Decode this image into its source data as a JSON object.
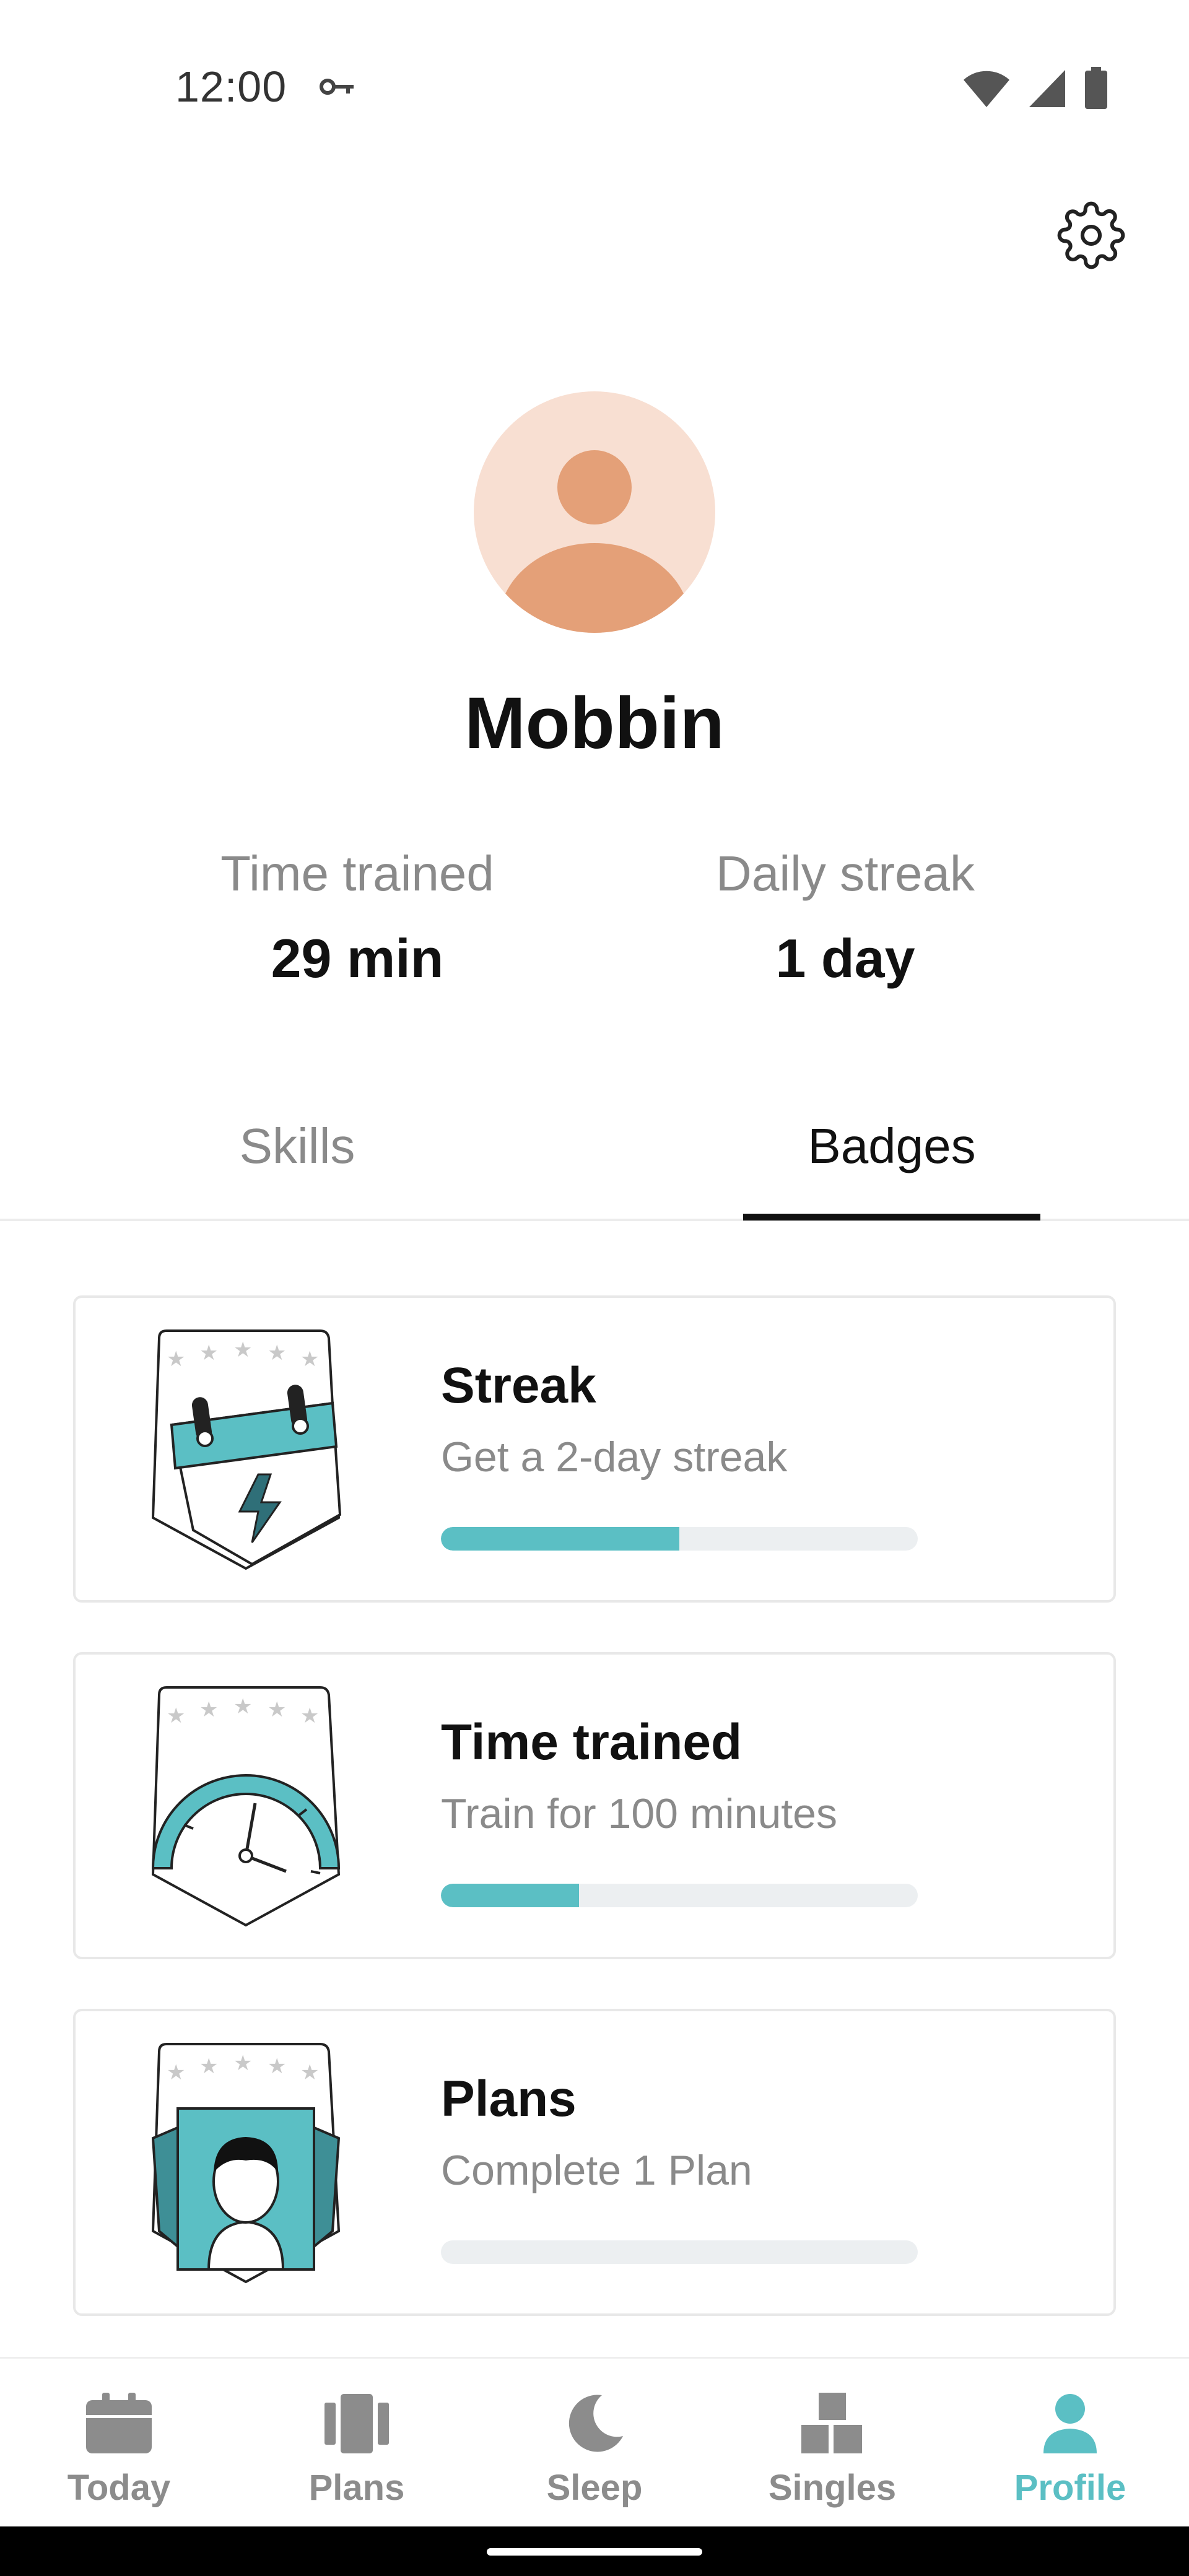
{
  "status_bar": {
    "time": "12:00"
  },
  "profile": {
    "name": "Mobbin"
  },
  "stats": [
    {
      "label": "Time trained",
      "value": "29 min"
    },
    {
      "label": "Daily streak",
      "value": "1 day"
    }
  ],
  "tabs": [
    {
      "label": "Skills",
      "active": false
    },
    {
      "label": "Badges",
      "active": true
    }
  ],
  "badges": [
    {
      "title": "Streak",
      "subtitle": "Get a 2-day streak",
      "progress": 0.5
    },
    {
      "title": "Time trained",
      "subtitle": "Train for 100 minutes",
      "progress": 0.29
    },
    {
      "title": "Plans",
      "subtitle": "Complete 1 Plan",
      "progress": 0
    }
  ],
  "nav": [
    {
      "label": "Today",
      "icon": "calendar-icon",
      "active": false
    },
    {
      "label": "Plans",
      "icon": "plans-icon",
      "active": false
    },
    {
      "label": "Sleep",
      "icon": "moon-icon",
      "active": false
    },
    {
      "label": "Singles",
      "icon": "blocks-icon",
      "active": false
    },
    {
      "label": "Profile",
      "icon": "person-icon",
      "active": true
    }
  ],
  "colors": {
    "accent": "#5bbfc4",
    "avatar_bg": "#f8dfd2",
    "avatar_fg": "#e4a078",
    "muted": "#8a8a8a"
  }
}
